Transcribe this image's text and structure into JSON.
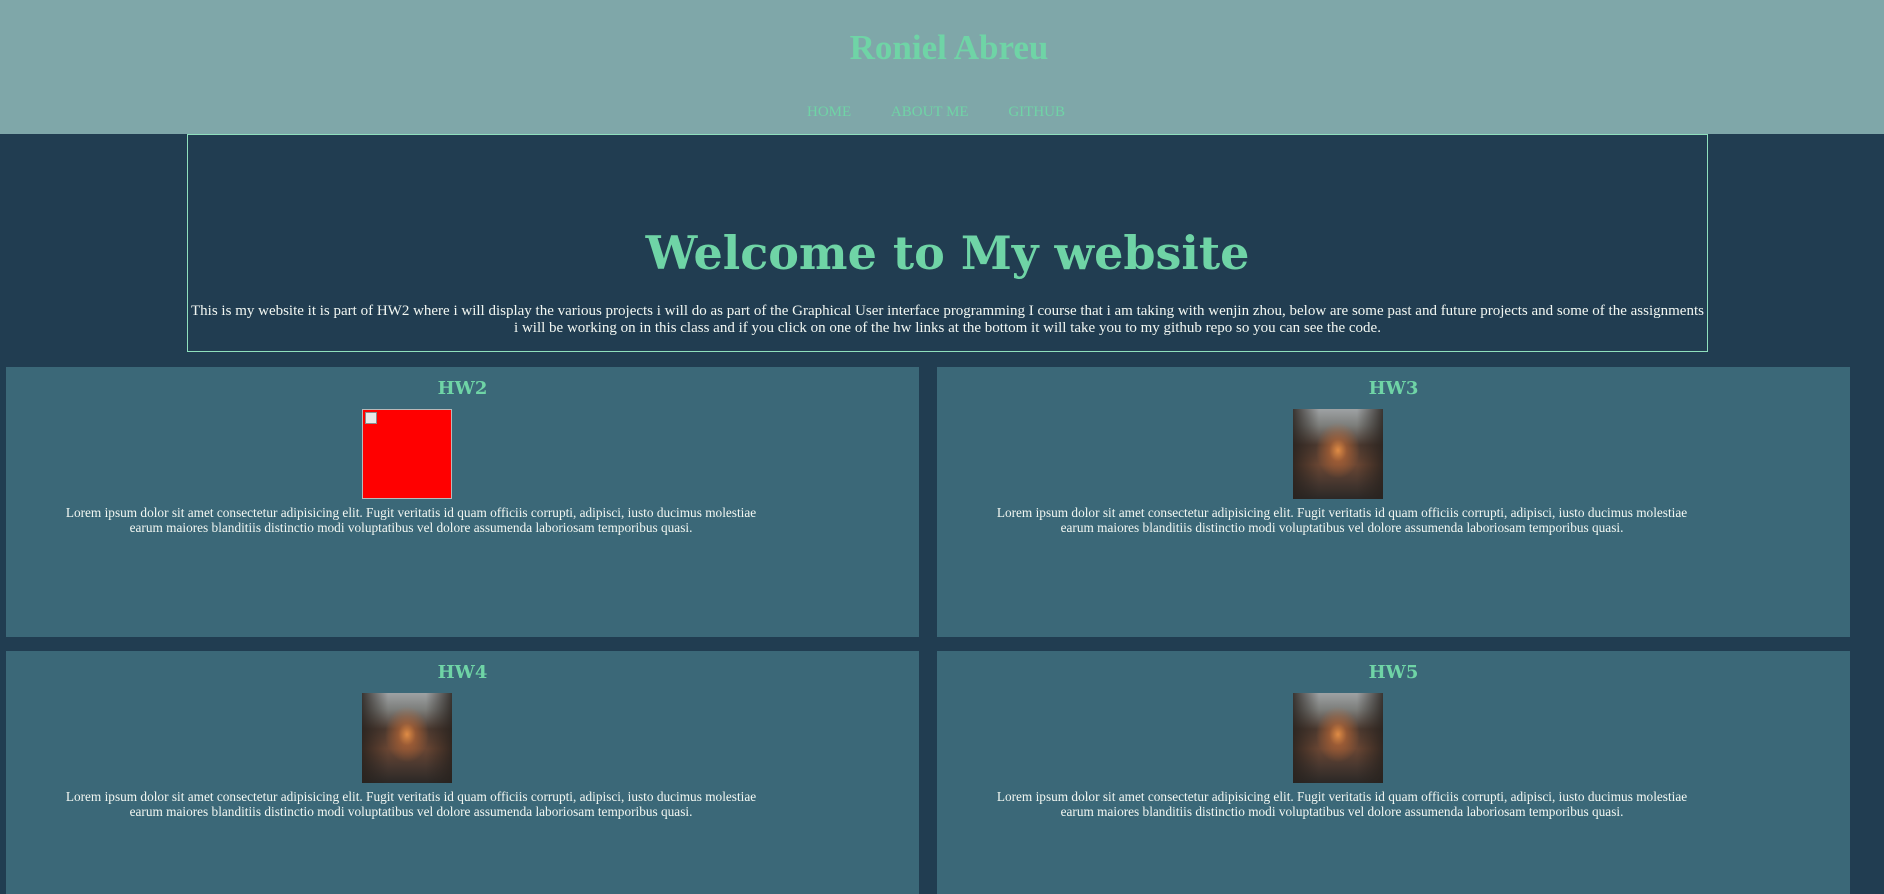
{
  "header": {
    "site_title": "Roniel Abreu",
    "nav": [
      "HOME",
      "ABOUT ME",
      "GITHUB"
    ]
  },
  "hero": {
    "title": "Welcome to My website",
    "text": "This is my website it is part of HW2 where i will display the various projects i will do as part of the Graphical User interface programming I course that i am taking with wenjin zhou, below are some past and future projects and some of the assignments i will be working on in this class and if you click on one of the hw links at the bottom it will take you to my github repo so you can see the code."
  },
  "cards": [
    {
      "title": "HW2",
      "image": "broken-image-icon",
      "text": "Lorem ipsum dolor sit amet consectetur adipisicing elit. Fugit veritatis id quam officiis corrupti, adipisci, iusto ducimus molestiae earum maiores blanditiis distinctio modi voluptatibus vel dolore assumenda laboriosam temporibus quasi."
    },
    {
      "title": "HW3",
      "image": "forest-path-photo",
      "text": "Lorem ipsum dolor sit amet consectetur adipisicing elit. Fugit veritatis id quam officiis corrupti, adipisci, iusto ducimus molestiae earum maiores blanditiis distinctio modi voluptatibus vel dolore assumenda laboriosam temporibus quasi."
    },
    {
      "title": "HW4",
      "image": "forest-path-photo",
      "text": "Lorem ipsum dolor sit amet consectetur adipisicing elit. Fugit veritatis id quam officiis corrupti, adipisci, iusto ducimus molestiae earum maiores blanditiis distinctio modi voluptatibus vel dolore assumenda laboriosam temporibus quasi."
    },
    {
      "title": "HW5",
      "image": "forest-path-photo",
      "text": "Lorem ipsum dolor sit amet consectetur adipisicing elit. Fugit veritatis id quam officiis corrupti, adipisci, iusto ducimus molestiae earum maiores blanditiis distinctio modi voluptatibus vel dolore assumenda laboriosam temporibus quasi."
    }
  ],
  "colors": {
    "header_bg": "#7fa7a9",
    "page_bg": "#213d51",
    "card_bg": "#3b6878",
    "accent": "#6fd4a6",
    "text": "#f2f7f2",
    "broken_image_bg": "#ff0000"
  }
}
